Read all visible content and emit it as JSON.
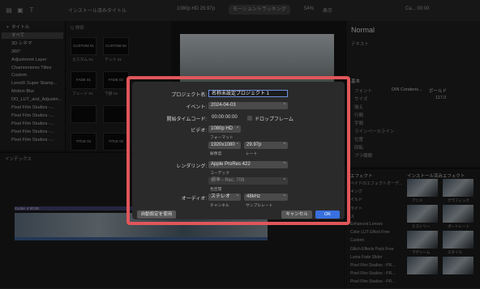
{
  "topbar": {
    "library_title": "インストール済みタイトル",
    "format_info": "1080p HD 29.97p",
    "viewer_title": "モーショントラッキング",
    "zoom": "54%",
    "view_label": "表示",
    "clip_info": "Ca... 00:00"
  },
  "sidebar": {
    "items": [
      {
        "label": "タイトル",
        "chevron": "▾"
      },
      {
        "label": "すべて",
        "chevron": "",
        "selected": true
      },
      {
        "label": "3D シネマ",
        "chevron": ""
      },
      {
        "label": "360°",
        "chevron": ""
      },
      {
        "label": "Adjustment Layer",
        "chevron": ""
      },
      {
        "label": "Chamomiores Titles",
        "chevron": ""
      },
      {
        "label": "Custom",
        "chevron": ""
      },
      {
        "label": "LenelX Super Stamp...",
        "chevron": ""
      },
      {
        "label": "Motion Blur",
        "chevron": ""
      },
      {
        "label": "DO_LUT_and_Adjustm...",
        "chevron": ""
      },
      {
        "label": "Pixel Film Studios -...",
        "chevron": ""
      },
      {
        "label": "Pixel Film Studios -...",
        "chevron": ""
      },
      {
        "label": "Pixel Film Studios -...",
        "chevron": ""
      },
      {
        "label": "Pixel Film Studios -...",
        "chevron": ""
      },
      {
        "label": "Pixel Film Studios -...",
        "chevron": ""
      }
    ]
  },
  "browser": {
    "search_placeholder": "Q 検索",
    "thumbs": [
      {
        "text": "CUSTOM 01",
        "label": "カスタム 01"
      },
      {
        "text": "CUSTOM 02",
        "label": "テック 01"
      },
      {
        "text": "FADE 01",
        "label": "フェード 01"
      },
      {
        "text": "FADE 02",
        "label": "下部 01"
      },
      {
        "text": "",
        "label": ""
      },
      {
        "text": "",
        "label": ""
      },
      {
        "text": "TITLE 01",
        "label": ""
      },
      {
        "text": "TITLE 02",
        "label": ""
      }
    ]
  },
  "inspector": {
    "title": "Normal",
    "section1": "テキスト",
    "section2": "基本",
    "rows": [
      "フォント",
      "サイズ",
      "揃え",
      "行間",
      "字間",
      "ラインベースライン",
      "位置",
      "回転",
      "ブラ類類"
    ],
    "font_value": "DIN Condens...",
    "weight_label": "ボールド",
    "size_value": "117.0"
  },
  "timeline": {
    "index_label": "インデックス",
    "clip_label": "Ca Bo: 4 00:00"
  },
  "effects": {
    "header": "エフェクト",
    "header2": "インストール済みエフェクト",
    "items": [
      "ペイドのエフェクトオーデ...",
      "キング",
      "イルド",
      "ライト",
      "ス",
      "Enhanced Lenses",
      "Color LUT Effect Free",
      "Custom",
      "Glitch Effects Pack Free",
      "Luma Fade Slider",
      "Pixel Film Studios - PR...",
      "Pixel Film Studios - PR...",
      "Pixel Film Studios - PR..."
    ],
    "thumbs": [
      "アニメ",
      "グラフィック",
      "ヒストリー",
      "ポートレート",
      "ラゲシーム",
      "スタイル",
      "",
      ""
    ]
  },
  "dialog": {
    "project_name_label": "プロジェクト名:",
    "project_name_value": "名称未設定プロジェクト 1",
    "event_label": "イベント:",
    "event_value": "2024-04-03",
    "start_tc_label": "開始タイムコード:",
    "start_tc_value": "00:00:00:00",
    "drop_frame_label": "ドロップフレーム",
    "video_label": "ビデオ:",
    "video_format": "1080p HD",
    "format_caption": "フォーマット",
    "resolution": "1920x1080",
    "resolution_caption": "解像度",
    "rate": "29.97p",
    "rate_caption": "レート",
    "rendering_label": "レンダリング:",
    "codec": "Apple ProRes 422",
    "codec_caption": "コーデック",
    "color_space": "標準 - Rec. 709",
    "color_space_caption": "色空間",
    "audio_label": "オーディオ:",
    "channels": "ステレオ",
    "channels_caption": "チャンネル",
    "sample_rate": "48kHz",
    "sample_rate_caption": "サンプルレート",
    "auto_settings_button": "自動設定を使用",
    "cancel_button": "キャンセル",
    "ok_button": "OK"
  }
}
